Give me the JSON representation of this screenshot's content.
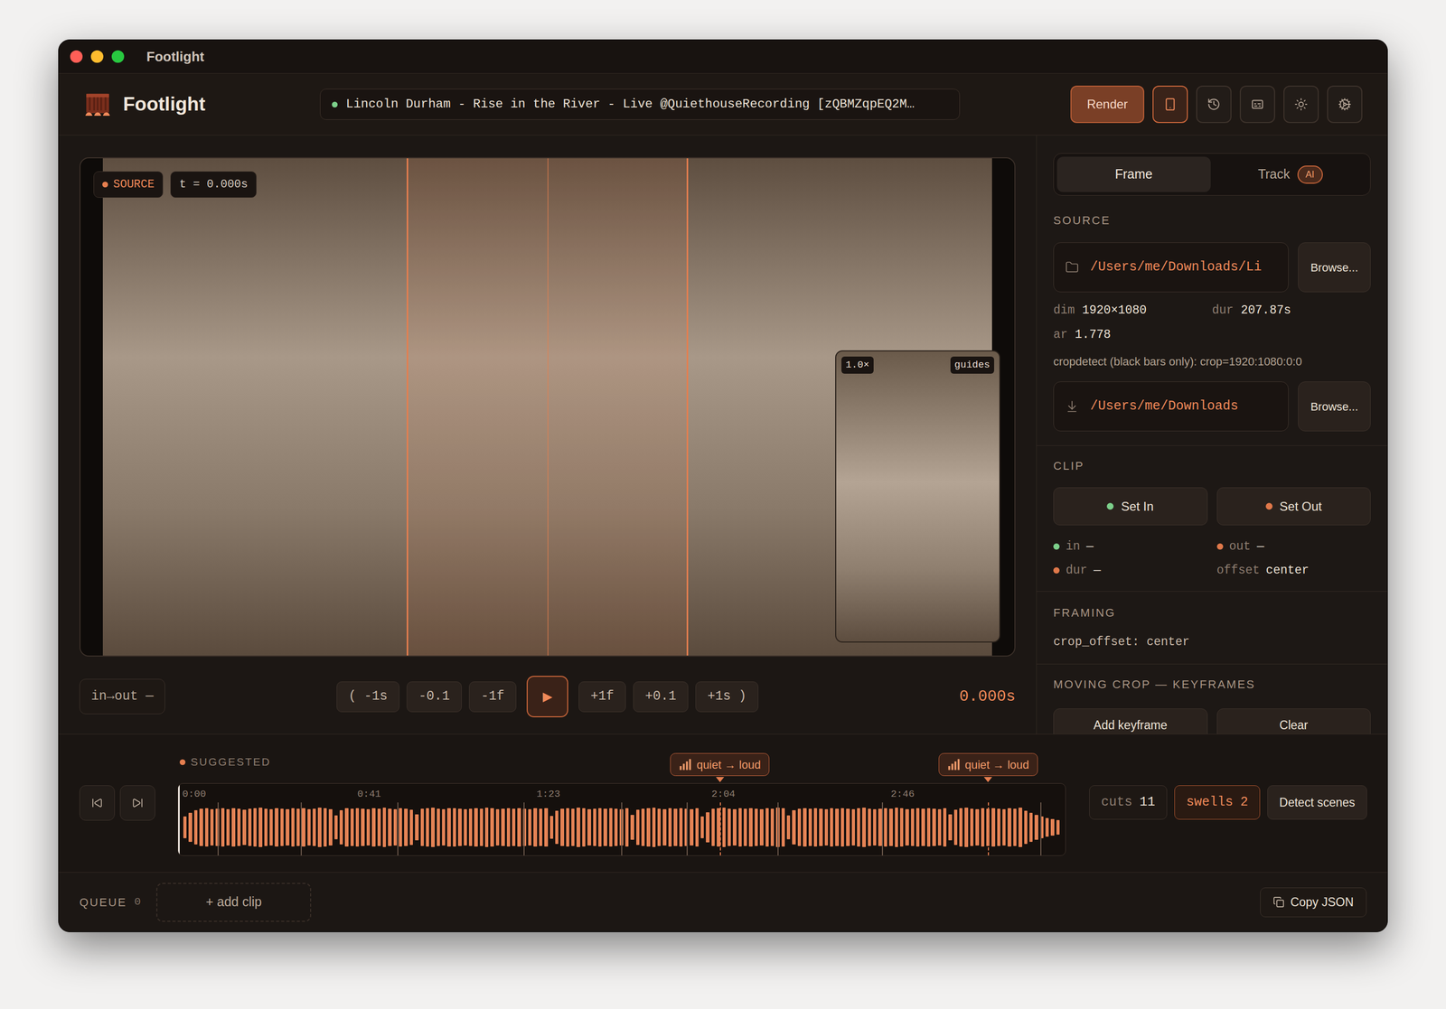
{
  "window": {
    "title": "Footlight",
    "controls": [
      {
        "color": "#ff5f57"
      },
      {
        "color": "#febc2e"
      },
      {
        "color": "#28c840"
      }
    ]
  },
  "header": {
    "app_name": "Footlight",
    "source_title": "Lincoln Durham - Rise in the River - Live @QuiethouseRecording [zQBMZqpEQ2M…",
    "status_color": "#7ccf8a",
    "render_button": "Render",
    "tool_buttons": [
      {
        "kind": "phone",
        "selected": true
      },
      {
        "kind": "history",
        "selected": false
      },
      {
        "kind": "captions",
        "selected": false
      },
      {
        "kind": "theme",
        "selected": false
      },
      {
        "kind": "settings",
        "selected": false
      }
    ]
  },
  "viewer": {
    "badge": "SOURCE",
    "time": "t = 0.000s",
    "crop_aspect": 0.5625,
    "preview": {
      "zoom": "1.0×",
      "guides": "guides"
    }
  },
  "transport": {
    "range": "in→out —",
    "back_buttons": [
      "( -1s",
      "-0.1",
      "-1f"
    ],
    "play": "▶",
    "forward_buttons": [
      "+1f",
      "+0.1",
      "+1s )"
    ],
    "time": "0.000s"
  },
  "panel": {
    "tabs": [
      {
        "label": "Frame",
        "selected": true,
        "badge": ""
      },
      {
        "label": "Track",
        "selected": false,
        "badge": "AI"
      }
    ],
    "source": {
      "label": "SOURCE",
      "input": "/Users/me/Downloads/Li",
      "browse": "Browse...",
      "meta": [
        {
          "key": "dim",
          "value": "1920×1080"
        },
        {
          "key": "dur",
          "value": "207.87s"
        },
        {
          "key": "ar",
          "value": "1.778"
        }
      ],
      "cropdetect": "cropdetect (black bars only): crop=1920:1080:0:0",
      "output": "/Users/me/Downloads",
      "output_browse": "Browse..."
    },
    "clip": {
      "label": "CLIP",
      "buttons": [
        {
          "label": "Set In",
          "color": "#7ccf8a"
        },
        {
          "label": "Set Out",
          "color": "#e0784a"
        }
      ],
      "fields": [
        {
          "key": "in",
          "value": "—",
          "color": "#7ccf8a"
        },
        {
          "key": "out",
          "value": "—",
          "color": "#e0784a"
        },
        {
          "key": "dur",
          "value": "—",
          "color": "#e0784a"
        },
        {
          "key": "offset",
          "value": "center",
          "color": ""
        }
      ]
    },
    "framing": {
      "label": "FRAMING",
      "value": "crop_offset: center"
    },
    "keyframes": {
      "label": "MOVING CROP — KEYFRAMES",
      "buttons": [
        "Add keyframe",
        "Clear"
      ]
    }
  },
  "timeline": {
    "label": "SUGGESTED",
    "duration_s": 207.87,
    "playhead_s": 0,
    "ticks": [
      {
        "label": "0:00",
        "t": 0
      },
      {
        "label": "0:41",
        "t": 41
      },
      {
        "label": "1:23",
        "t": 83
      },
      {
        "label": "2:04",
        "t": 124
      },
      {
        "label": "2:46",
        "t": 166
      }
    ],
    "swells": [
      {
        "label": "quiet → loud",
        "t": 126.9
      },
      {
        "label": "quiet → loud",
        "t": 189.7
      }
    ],
    "cuts": [
      9.3,
      28.7,
      51.4,
      80.9,
      103.8,
      119.2,
      140.5,
      164.9,
      202.0
    ],
    "waveform": [
      0.45,
      0.6,
      0.72,
      0.78,
      0.8,
      0.76,
      0.79,
      0.81,
      0.77,
      0.8,
      0.78,
      0.74,
      0.79,
      0.8,
      0.82,
      0.78,
      0.76,
      0.8,
      0.79,
      0.77,
      0.81,
      0.78,
      0.8,
      0.76,
      0.79,
      0.82,
      0.8,
      0.77,
      0.5,
      0.72,
      0.8,
      0.78,
      0.81,
      0.79,
      0.76,
      0.8,
      0.78,
      0.82,
      0.79,
      0.77,
      0.8,
      0.78,
      0.74,
      0.55,
      0.78,
      0.8,
      0.82,
      0.79,
      0.77,
      0.8,
      0.81,
      0.78,
      0.76,
      0.79,
      0.8,
      0.78,
      0.82,
      0.8,
      0.77,
      0.79,
      0.81,
      0.78,
      0.8,
      0.79,
      0.76,
      0.8,
      0.78,
      0.81,
      0.48,
      0.7,
      0.79,
      0.8,
      0.78,
      0.82,
      0.8,
      0.77,
      0.79,
      0.81,
      0.78,
      0.8,
      0.79,
      0.76,
      0.8,
      0.52,
      0.74,
      0.78,
      0.8,
      0.82,
      0.79,
      0.77,
      0.8,
      0.78,
      0.81,
      0.79,
      0.76,
      0.8,
      0.45,
      0.62,
      0.78,
      0.8,
      0.82,
      0.79,
      0.77,
      0.8,
      0.78,
      0.81,
      0.79,
      0.76,
      0.8,
      0.78,
      0.82,
      0.8,
      0.5,
      0.72,
      0.79,
      0.81,
      0.78,
      0.8,
      0.79,
      0.76,
      0.8,
      0.78,
      0.81,
      0.79,
      0.77,
      0.8,
      0.82,
      0.78,
      0.76,
      0.79,
      0.8,
      0.78,
      0.82,
      0.8,
      0.77,
      0.79,
      0.81,
      0.78,
      0.8,
      0.79,
      0.76,
      0.8,
      0.55,
      0.74,
      0.8,
      0.82,
      0.79,
      0.77,
      0.8,
      0.78,
      0.81,
      0.79,
      0.76,
      0.8,
      0.78,
      0.82,
      0.7,
      0.6,
      0.52,
      0.45,
      0.4,
      0.35,
      0.3
    ],
    "cuts_button": {
      "label": "cuts",
      "count": "11",
      "selected": false
    },
    "swells_button": {
      "label": "swells",
      "count": "2",
      "selected": true
    },
    "detect_button": "Detect scenes"
  },
  "queue": {
    "label": "QUEUE",
    "count": "0",
    "add": "+ add clip",
    "copy": "Copy JSON"
  }
}
